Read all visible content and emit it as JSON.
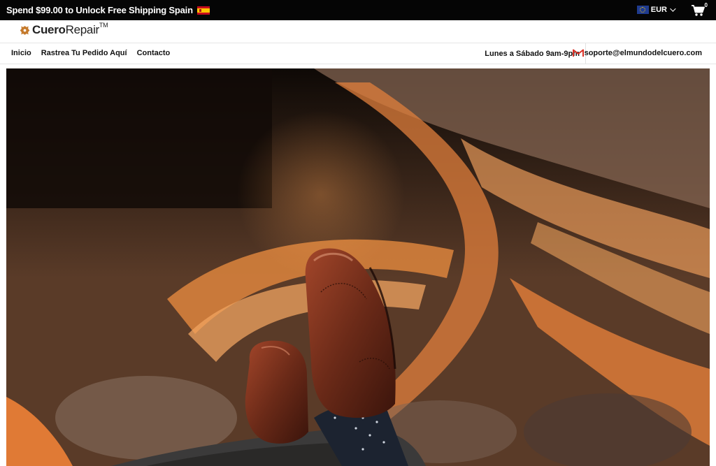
{
  "announcement": {
    "text": "Spend $99.00 to Unlock Free Shipping Spain",
    "flag_icon": "spain-flag-icon"
  },
  "currency": {
    "code": "EUR",
    "flag_icon": "eu-flag-icon"
  },
  "cart": {
    "icon": "cart-icon",
    "count": "0"
  },
  "logo": {
    "part1": "Cuero",
    "part2": "Repair",
    "tm": "TM"
  },
  "nav": {
    "items": [
      "Inicio",
      "Rastrea Tu Pedido Aquí",
      "Contacto"
    ]
  },
  "contact": {
    "hours": "Lunes a Sábado 9am-9pm",
    "email": "soporte@elmundodelcuero.com",
    "email_icon": "gmail-icon"
  },
  "colors": {
    "announce_bg": "#050505",
    "accent": "#c2692e",
    "shoe": "#6b2a18"
  }
}
